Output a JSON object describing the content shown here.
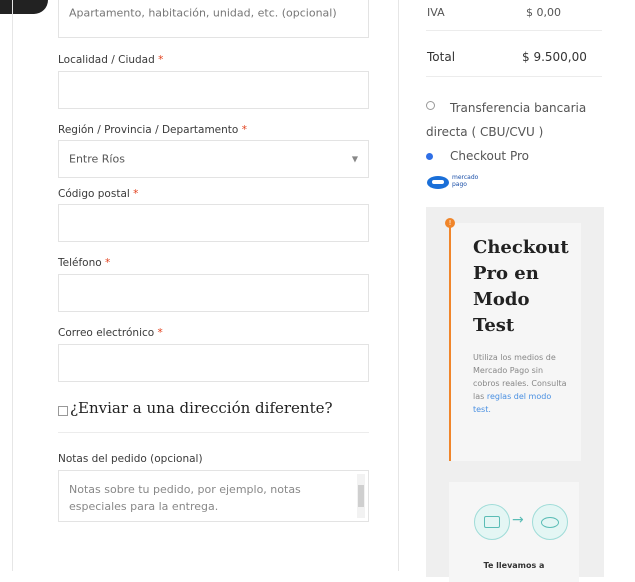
{
  "colors": {
    "required": "#e2401c",
    "radio_selected": "#2f6fe6",
    "notice_orange": "#f0852a",
    "link_blue": "#4a90e2"
  },
  "billing": {
    "apartment_placeholder": "Apartamento, habitación, unidad, etc. (opcional)",
    "locality_label": "Localidad / Ciudad",
    "region_label": "Región / Provincia / Departamento",
    "region_value": "Entre Ríos",
    "postal_label": "Código postal",
    "phone_label": "Teléfono",
    "email_label": "Correo electrónico",
    "required_mark": "*",
    "ship_different_label": "¿Enviar a una dirección diferente?",
    "notes_label": "Notas del pedido (opcional)",
    "notes_placeholder": "Notas sobre tu pedido, por ejemplo, notas especiales para la entrega."
  },
  "summary": {
    "partial_label": "IVA",
    "partial_value": "$ 0,00",
    "total_label": "Total",
    "total_value": "$ 9.500,00"
  },
  "payment": {
    "bank_transfer_label": "Transferencia bancaria directa ( CBU/CVU )",
    "checkout_pro_label": "Checkout Pro",
    "logo_text_1": "mercado",
    "logo_text_2": "pago",
    "notice_title": "Checkout Pro en Modo Test",
    "notice_text": "Utiliza los medios de Mercado Pago sin cobros reales. Consulta",
    "notice_link_prefix": "las",
    "notice_link": "reglas del modo test.",
    "notice_mark": "!",
    "promo_text": "Te llevamos a"
  }
}
